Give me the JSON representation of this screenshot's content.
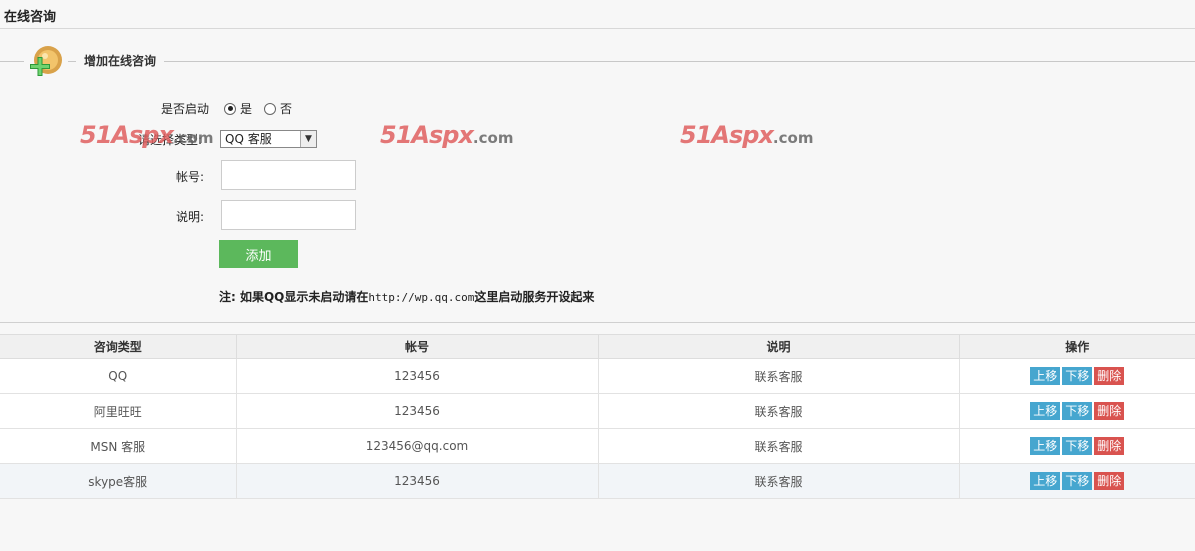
{
  "page": {
    "title": "在线咨询"
  },
  "section": {
    "title": "增加在线咨询",
    "icon": "add-user-icon"
  },
  "form": {
    "enable_label": "是否启动",
    "enable_yes": "是",
    "enable_no": "否",
    "enable_value": "是",
    "type_label": "请选择类型:",
    "type_value": "QQ 客服",
    "account_label": "帐号:",
    "account_value": "",
    "desc_label": "说明:",
    "desc_value": "",
    "add_label": "添加",
    "note_prefix": "注: 如果QQ显示未启动请在",
    "note_url": "http://wp.qq.com",
    "note_suffix": "这里启动服务开设起来"
  },
  "watermark": {
    "main": "51Aspx",
    "tail": ".com"
  },
  "table": {
    "columns": [
      "咨询类型",
      "帐号",
      "说明",
      "操作"
    ],
    "actions": {
      "up": "上移",
      "down": "下移",
      "delete": "删除"
    },
    "rows": [
      {
        "type": "QQ",
        "account": "123456",
        "desc": "联系客服"
      },
      {
        "type": "阿里旺旺",
        "account": "123456",
        "desc": "联系客服"
      },
      {
        "type": "MSN 客服",
        "account": "123456@qq.com",
        "desc": "联系客服"
      },
      {
        "type": "skype客服",
        "account": "123456",
        "desc": "联系客服"
      }
    ]
  },
  "colors": {
    "add_button": "#5cb85c",
    "move_button": "#46a6cf",
    "delete_button": "#d9534f"
  }
}
